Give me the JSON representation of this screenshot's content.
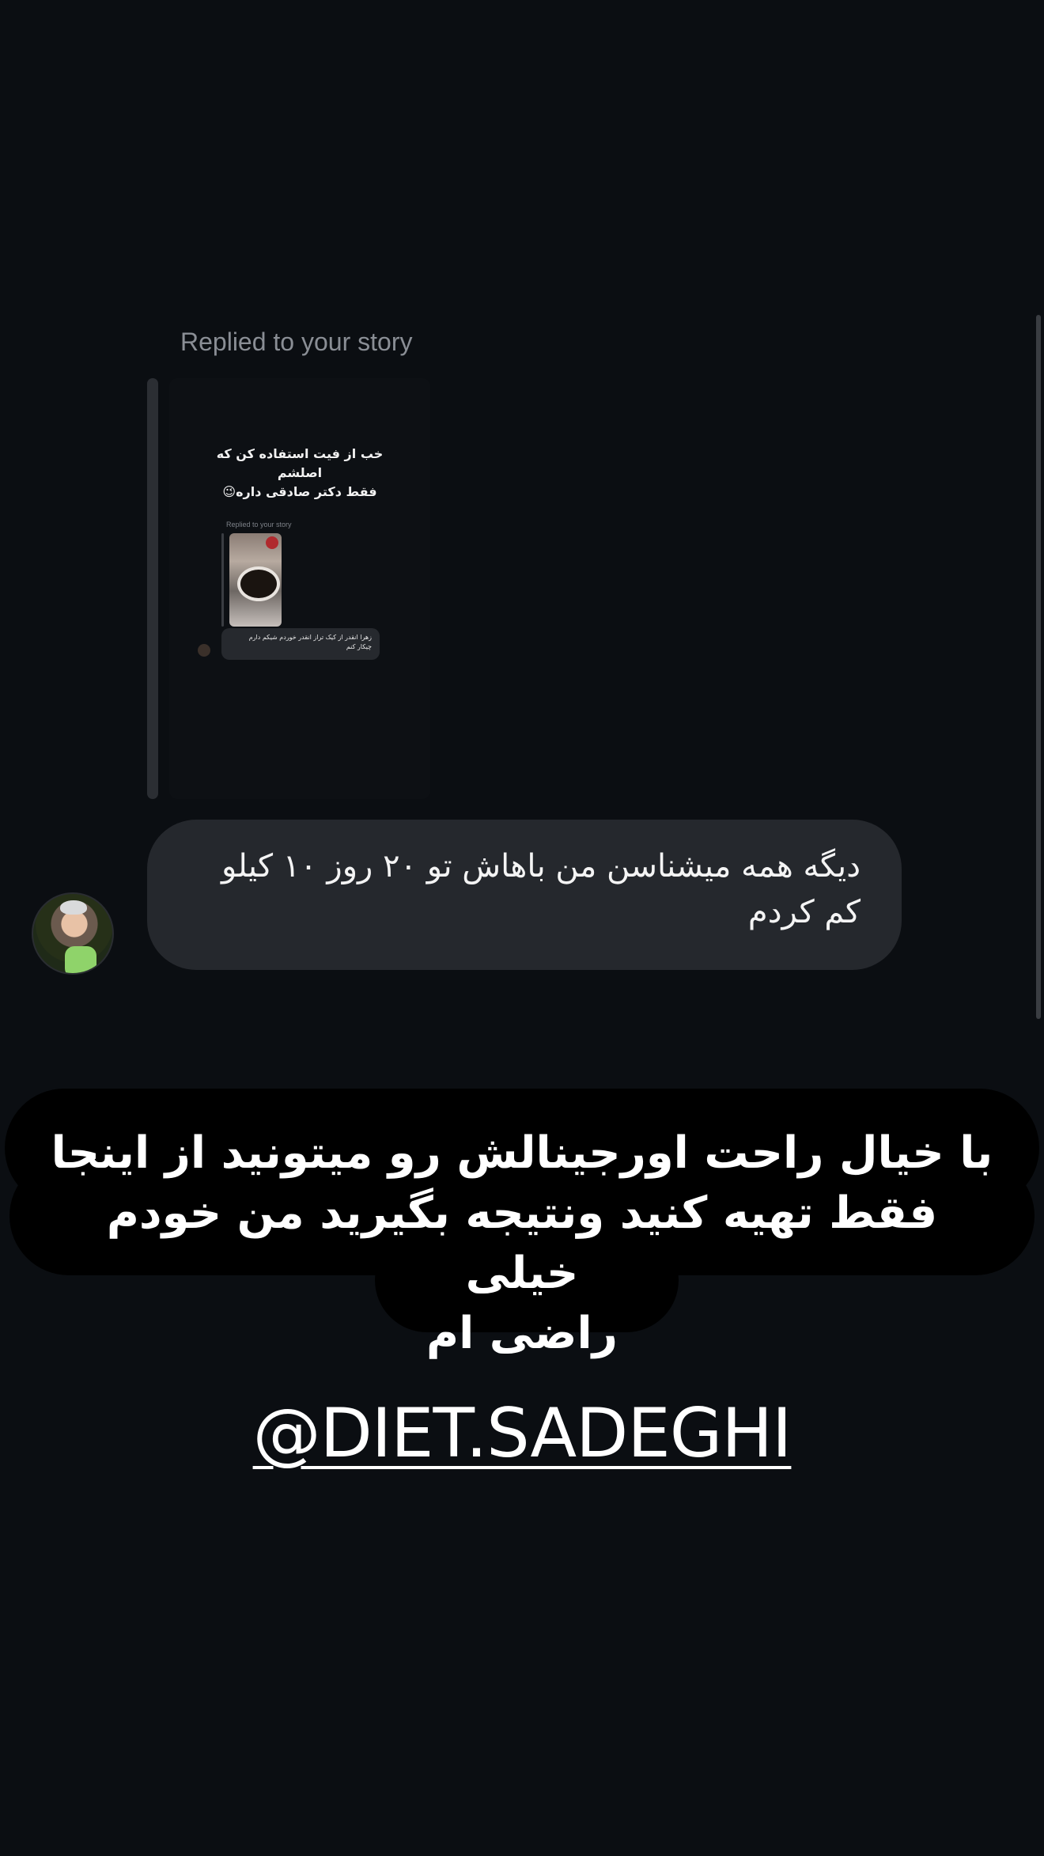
{
  "story_reply": {
    "replied_label": "Replied to your story",
    "preview": {
      "caption_lines": "خب از فیت استفاده کن که اصلشم\nفقط دکتر صادقی داره😉",
      "nested_replied_label": "Replied to your story",
      "nested_message": "زهرا انقدر از کیک تراز انقدر خوردم شیکم دارم\nچیکار کنم"
    }
  },
  "message": {
    "text": "دیگه همه میشناسن من باهاش تو ۲۰ روز ۱۰ کیلو\nکم کردم"
  },
  "banner": {
    "lines": [
      "با خیال راحت اورجینالش رو میتونید از اینجا",
      "فقط تهیه کنید ونتیجه بگیرید من خودم خیلی",
      "راضی ام"
    ]
  },
  "mention": {
    "handle": "@DIET.SADEGHI"
  },
  "colors": {
    "background": "#0b0e12",
    "bubble": "#25282d",
    "banner": "#000000",
    "text": "#ffffff"
  }
}
